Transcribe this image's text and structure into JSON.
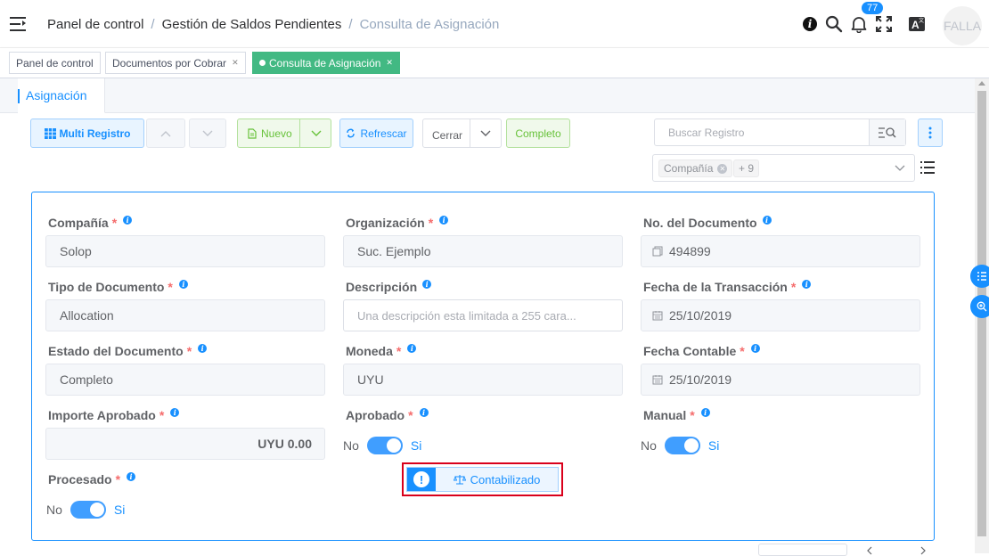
{
  "header": {
    "breadcrumbs": [
      "Panel de control",
      "Gestión de Saldos Pendientes",
      "Consulta de Asignación"
    ],
    "notification_count": "77",
    "avatar_text": "FALLA"
  },
  "tags_view": [
    {
      "label": "Panel de control",
      "closable": false,
      "active": false
    },
    {
      "label": "Documentos por Cobrar",
      "closable": true,
      "active": false
    },
    {
      "label": "Consulta de Asignación",
      "closable": true,
      "active": true
    }
  ],
  "tab": {
    "label": "Asignación"
  },
  "toolbar": {
    "multi_record": "Multi Registro",
    "new": "Nuevo",
    "refresh": "Refrescar",
    "close": "Cerrar",
    "complete": "Completo",
    "search_placeholder": "Buscar Registro",
    "filter_tag": "Compañía",
    "filter_more": "+ 9"
  },
  "fields": {
    "company": {
      "label": "Compañía",
      "value": "Solop"
    },
    "organization": {
      "label": "Organización",
      "value": "Suc. Ejemplo"
    },
    "document_no": {
      "label": "No. del Documento",
      "value": "494899"
    },
    "document_type": {
      "label": "Tipo de Documento",
      "value": "Allocation"
    },
    "description": {
      "label": "Descripción",
      "placeholder": "Una descripción esta limitada a 255 cara..."
    },
    "transaction_date": {
      "label": "Fecha de la Transacción",
      "value": "25/10/2019"
    },
    "document_status": {
      "label": "Estado del Documento",
      "value": "Completo"
    },
    "currency": {
      "label": "Moneda",
      "value": "UYU"
    },
    "accounting_date": {
      "label": "Fecha Contable",
      "value": "25/10/2019"
    },
    "approved_amount": {
      "label": "Importe Aprobado",
      "value": "UYU 0.00"
    },
    "approved": {
      "label": "Aprobado",
      "off": "No",
      "on": "Si"
    },
    "manual": {
      "label": "Manual",
      "off": "No",
      "on": "Si"
    },
    "processed": {
      "label": "Procesado",
      "off": "No",
      "on": "Si"
    }
  },
  "status_button": {
    "label": "Contabilizado"
  },
  "colors": {
    "primary": "#1890ff",
    "success": "#42b983",
    "required": "#f56c6c",
    "highlight": "#d9001b"
  }
}
